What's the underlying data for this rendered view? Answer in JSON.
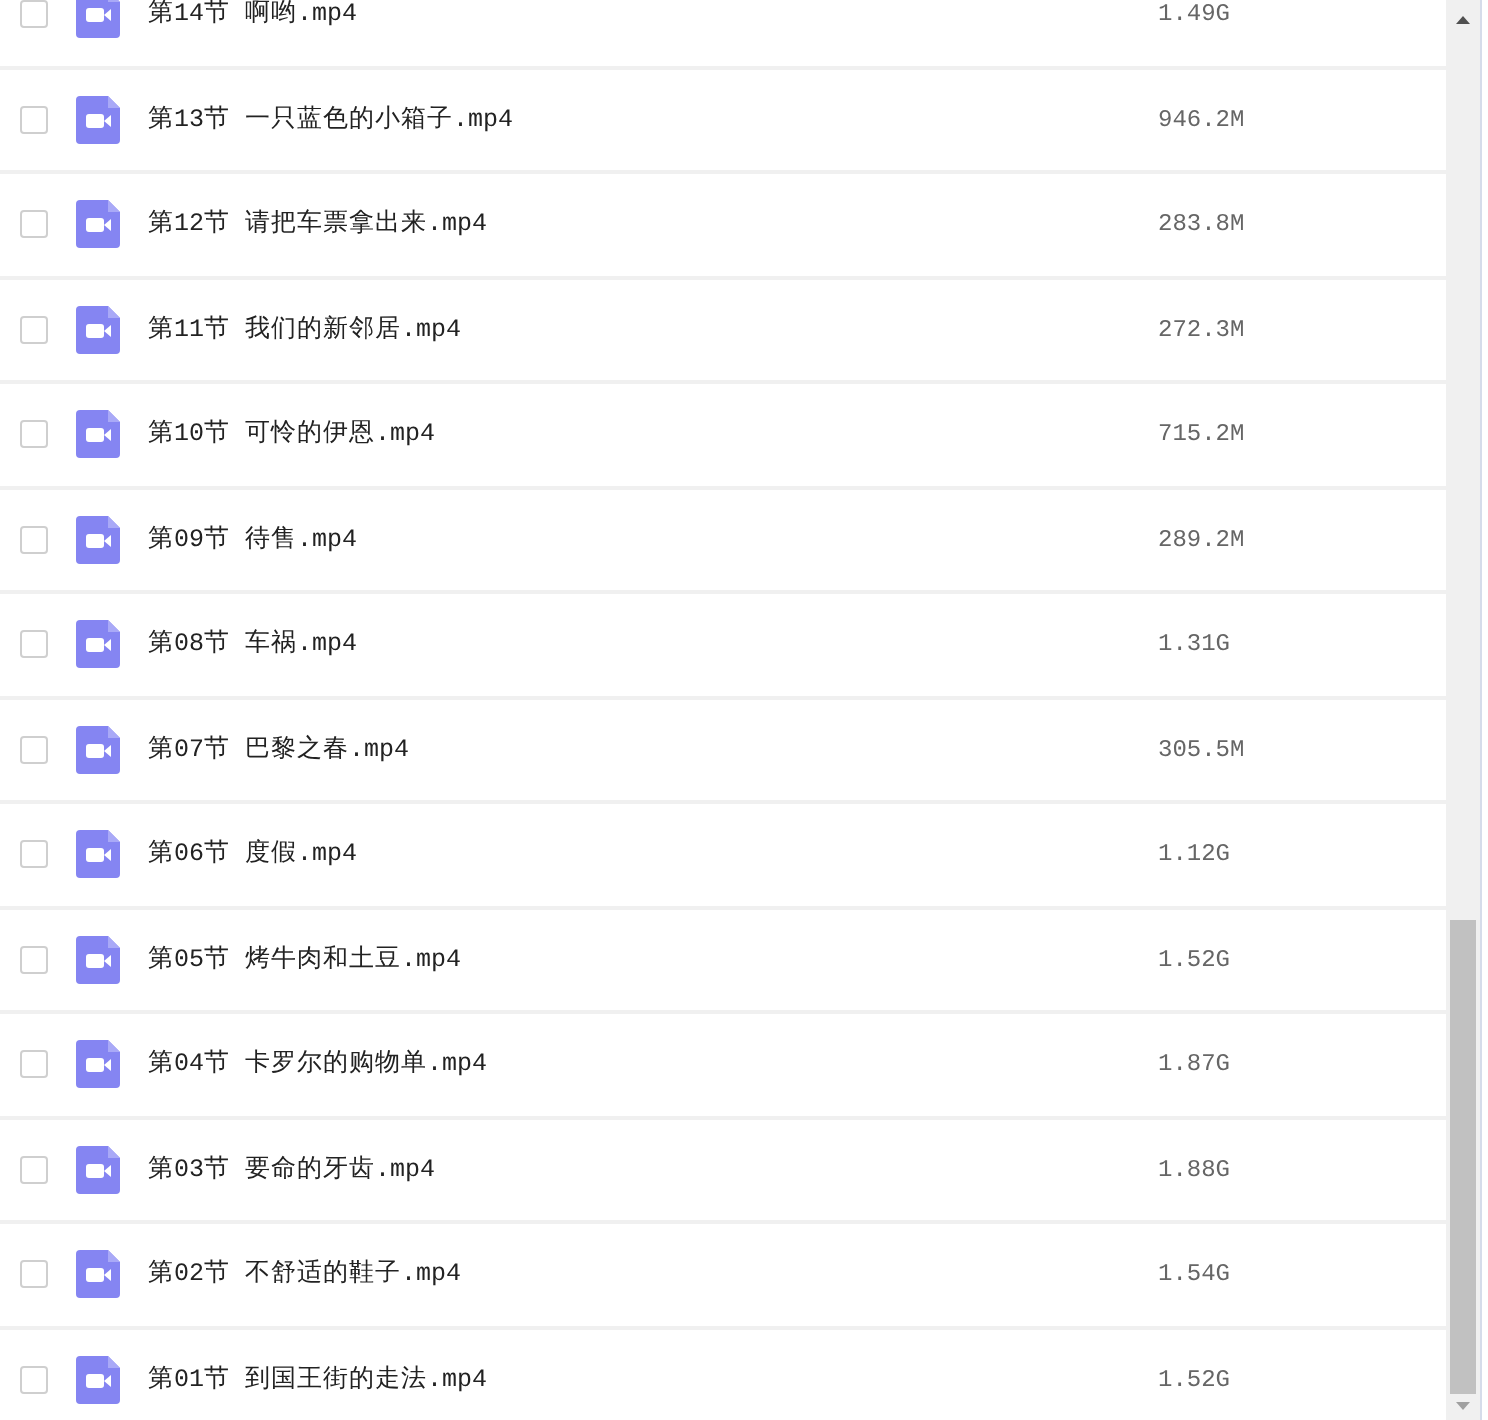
{
  "files": [
    {
      "name": "第14节 啊哟.mp4",
      "size": "1.49G",
      "checked": false
    },
    {
      "name": "第13节 一只蓝色的小箱子.mp4",
      "size": "946.2M",
      "checked": false
    },
    {
      "name": "第12节 请把车票拿出来.mp4",
      "size": "283.8M",
      "checked": false
    },
    {
      "name": "第11节 我们的新邻居.mp4",
      "size": "272.3M",
      "checked": false
    },
    {
      "name": "第10节 可怜的伊恩.mp4",
      "size": "715.2M",
      "checked": false
    },
    {
      "name": "第09节 待售.mp4",
      "size": "289.2M",
      "checked": false
    },
    {
      "name": "第08节 车祸.mp4",
      "size": "1.31G",
      "checked": false
    },
    {
      "name": "第07节 巴黎之春.mp4",
      "size": "305.5M",
      "checked": false
    },
    {
      "name": "第06节 度假.mp4",
      "size": "1.12G",
      "checked": false
    },
    {
      "name": "第05节 烤牛肉和土豆.mp4",
      "size": "1.52G",
      "checked": false
    },
    {
      "name": "第04节 卡罗尔的购物单.mp4",
      "size": "1.87G",
      "checked": false
    },
    {
      "name": "第03节 要命的牙齿.mp4",
      "size": "1.88G",
      "checked": false
    },
    {
      "name": "第02节 不舒适的鞋子.mp4",
      "size": "1.54G",
      "checked": false
    },
    {
      "name": "第01节 到国王街的走法.mp4",
      "size": "1.52G",
      "checked": false
    }
  ]
}
